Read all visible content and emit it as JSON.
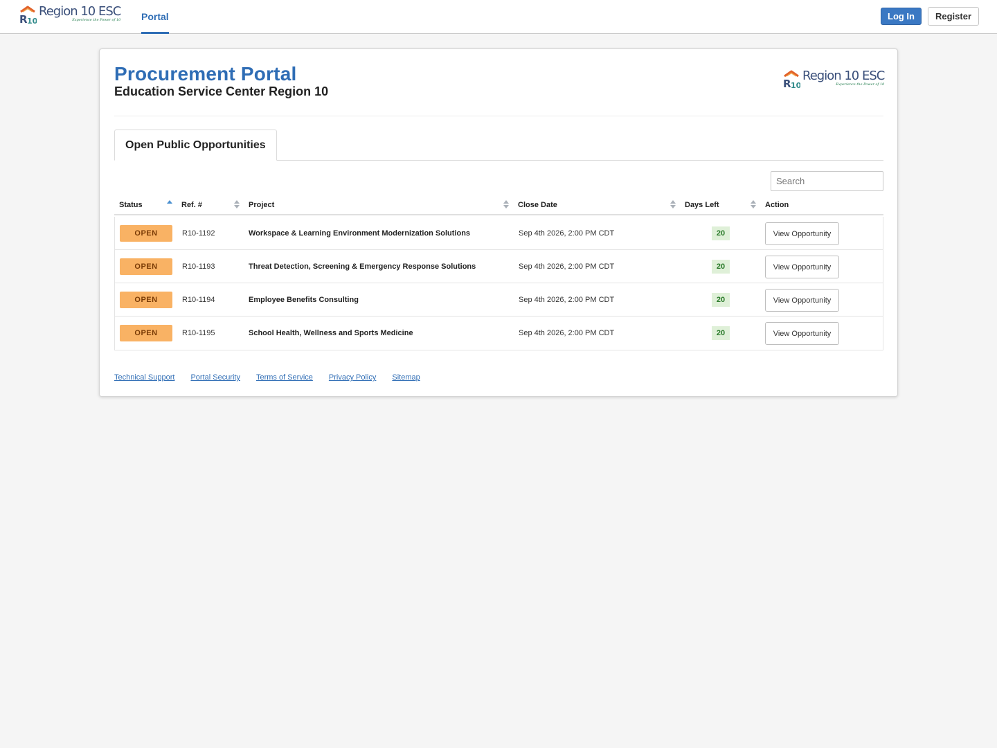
{
  "header": {
    "logo_name": "Region 10 ESC",
    "logo_tagline": "Experience the Power of 10",
    "nav_portal": "Portal",
    "login_label": "Log In",
    "register_label": "Register"
  },
  "page": {
    "title": "Procurement Portal",
    "subtitle": "Education Service Center Region 10",
    "tab_label": "Open Public Opportunities",
    "search_placeholder": "Search"
  },
  "table": {
    "columns": [
      "Status",
      "Ref. #",
      "Project",
      "Close Date",
      "Days Left",
      "Action"
    ],
    "sorted_column": "Status",
    "sort_direction": "ascending",
    "rows": [
      {
        "status": "OPEN",
        "ref": "R10-1192",
        "project": "Workspace & Learning Environment Modernization Solutions",
        "close_date": "Sep 4th 2026, 2:00 PM CDT",
        "days_left": "20",
        "action": "View Opportunity"
      },
      {
        "status": "OPEN",
        "ref": "R10-1193",
        "project": "Threat Detection, Screening & Emergency Response Solutions",
        "close_date": "Sep 4th 2026, 2:00 PM CDT",
        "days_left": "20",
        "action": "View Opportunity"
      },
      {
        "status": "OPEN",
        "ref": "R10-1194",
        "project": "Employee Benefits Consulting",
        "close_date": "Sep 4th 2026, 2:00 PM CDT",
        "days_left": "20",
        "action": "View Opportunity"
      },
      {
        "status": "OPEN",
        "ref": "R10-1195",
        "project": "School Health, Wellness and Sports Medicine",
        "close_date": "Sep 4th 2026, 2:00 PM CDT",
        "days_left": "20",
        "action": "View Opportunity"
      }
    ]
  },
  "footer": {
    "links": [
      "Technical Support",
      "Portal Security",
      "Terms of Service",
      "Privacy Policy",
      "Sitemap"
    ]
  },
  "colors": {
    "primary": "#2f6db5",
    "login_button": "#3a78c3",
    "open_badge": "#f9b264",
    "days_badge": "#dff0d8",
    "background": "#f5f5f5"
  },
  "icons": [
    "region10-logo-icon",
    "sort-ascending-icon",
    "sort-icon"
  ]
}
